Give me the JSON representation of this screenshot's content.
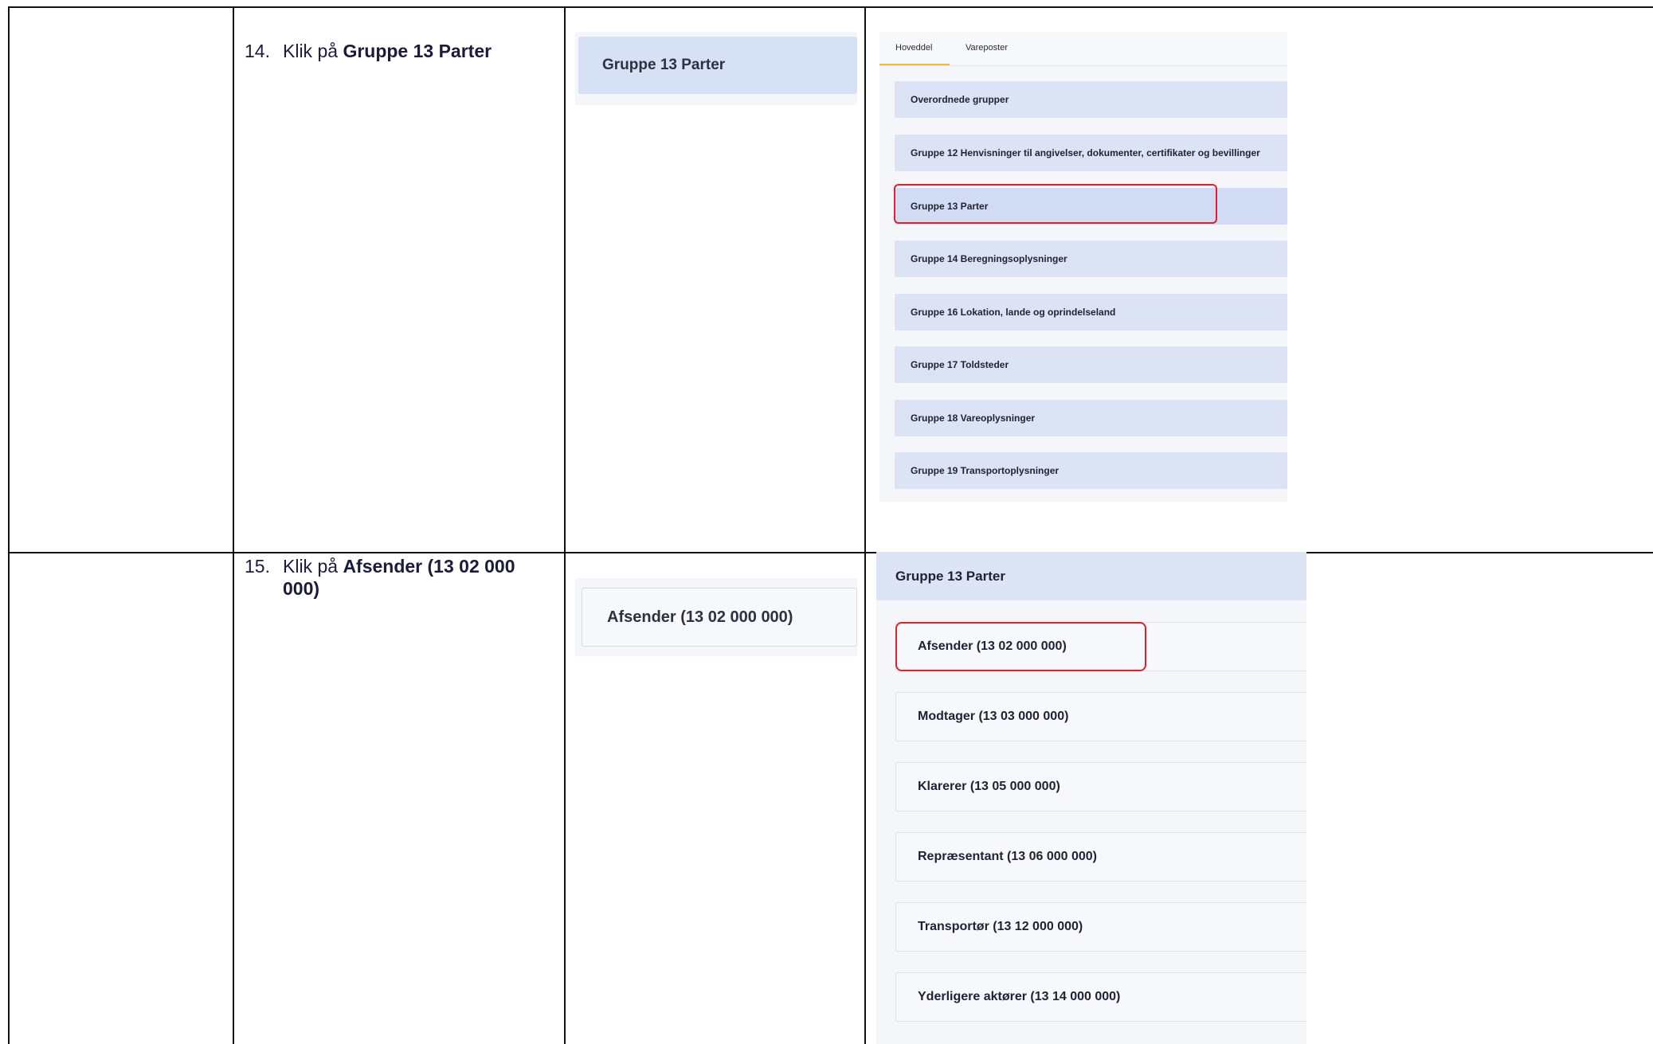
{
  "row1": {
    "step_number": "14.",
    "step_prefix": "Klik på",
    "step_bold": "Gruppe 13 Parter",
    "crop_label": "Gruppe 13 Parter",
    "shot": {
      "tabs": [
        "Hoveddel",
        "Vareposter"
      ],
      "active_tab": "Hoveddel",
      "accent_color": "#f2b43c",
      "groups": [
        "Overordnede grupper",
        "Gruppe 12 Henvisninger til angivelser, dokumenter, certifikater og bevillinger",
        "Gruppe 13 Parter",
        "Gruppe 14 Beregningsoplysninger",
        "Gruppe 16 Lokation, lande og oprindelseland",
        "Gruppe 17 Toldsteder",
        "Gruppe 18 Vareoplysninger",
        "Gruppe 19 Transportoplysninger"
      ],
      "highlighted": "Gruppe 13 Parter",
      "highlight_color": "#e0202a"
    }
  },
  "row2": {
    "step_number": "15.",
    "step_prefix": "Klik på",
    "step_bold_line1": "Afsender (13 02 000",
    "step_bold_line2": "000)",
    "crop_label": "Afsender (13 02 000 000)",
    "shot": {
      "header": "Gruppe 13 Parter",
      "parties": [
        "Afsender (13 02 000 000)",
        "Modtager (13 03 000 000)",
        "Klarerer (13 05 000 000)",
        "Repræsentant (13 06 000 000)",
        "Transportør (13 12 000 000)",
        "Yderligere aktører (13 14 000 000)"
      ],
      "highlighted": "Afsender (13 02 000 000)",
      "highlight_color": "#e0202a"
    }
  }
}
